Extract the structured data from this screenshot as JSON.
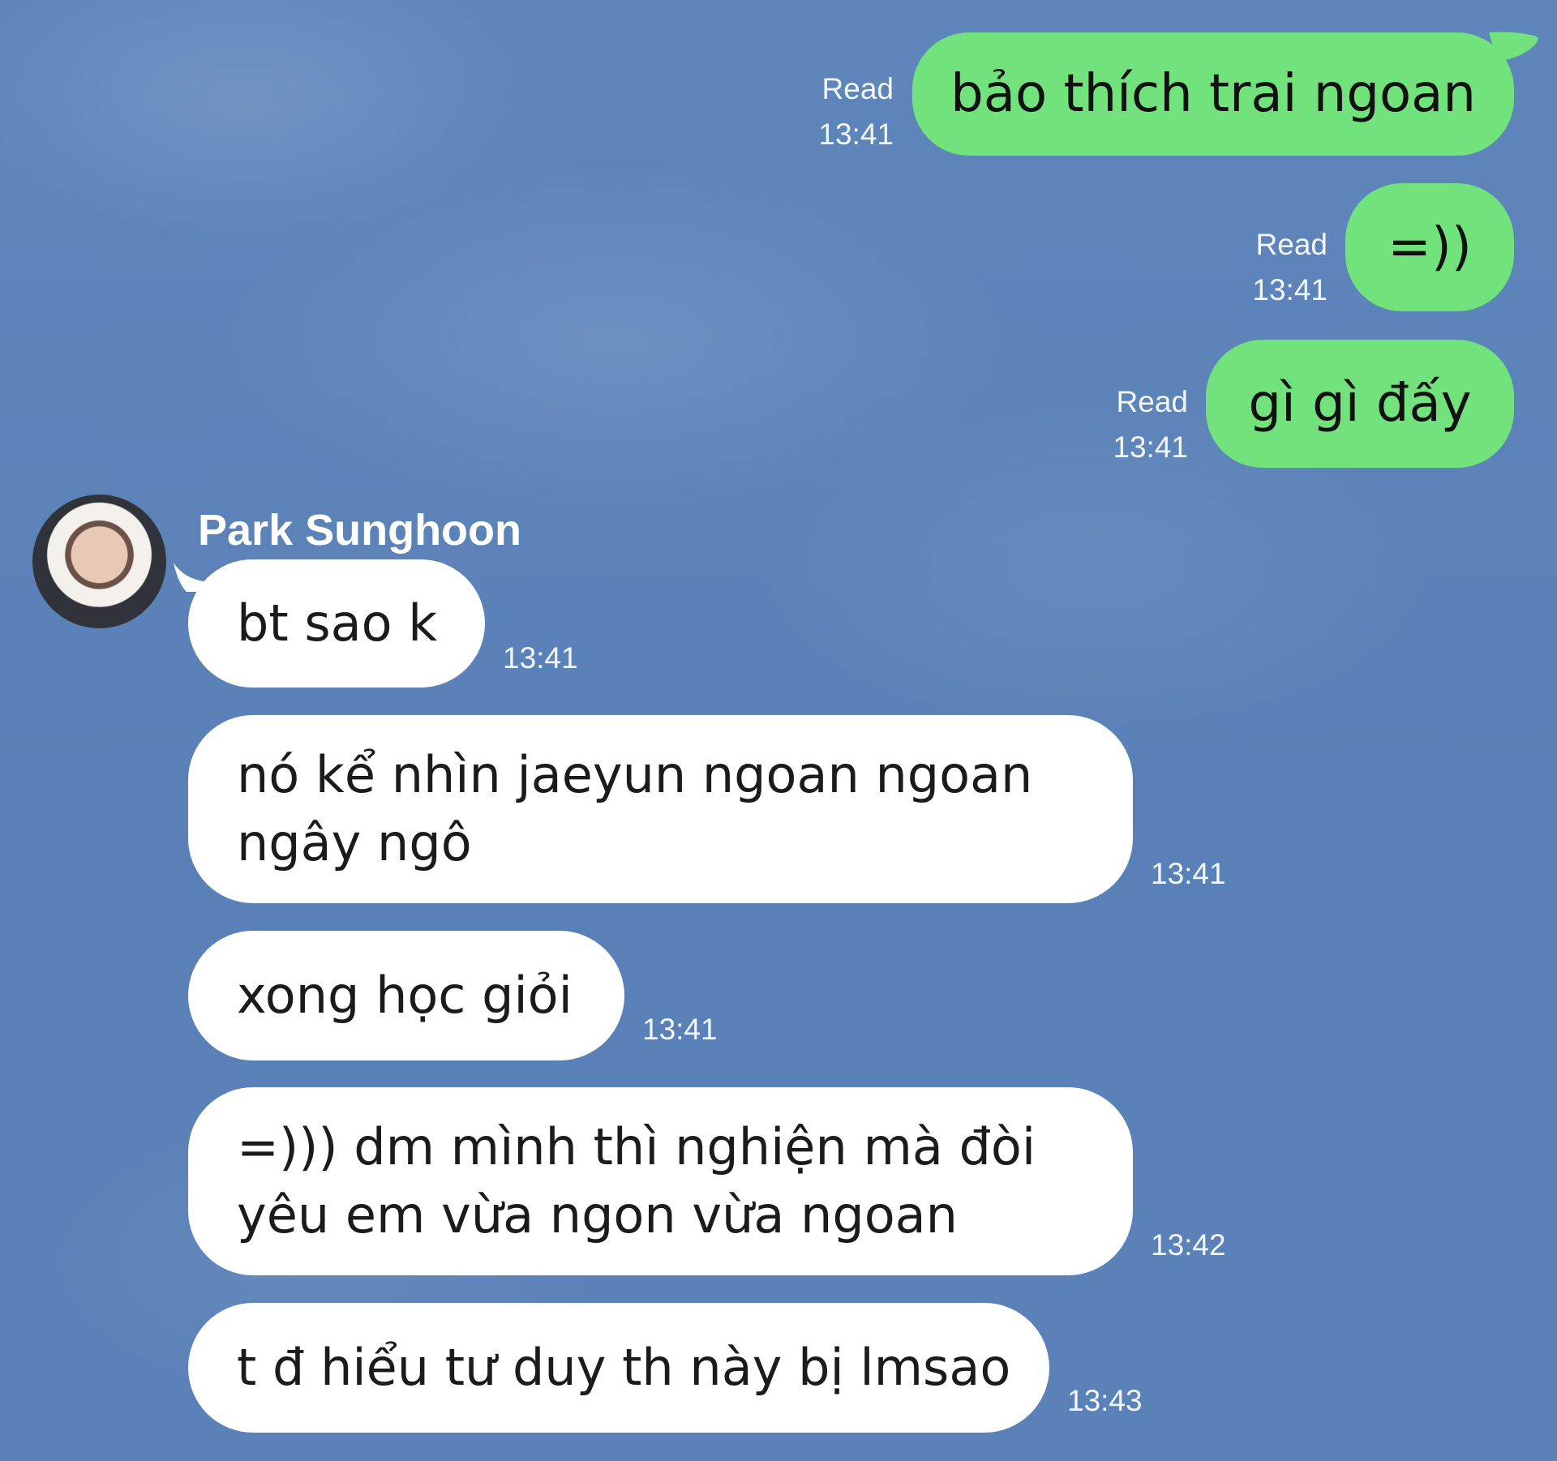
{
  "chat": {
    "outgoing": [
      {
        "text": "bảo thích trai ngoan",
        "status": "Read",
        "time": "13:41"
      },
      {
        "text": "=))",
        "status": "Read",
        "time": "13:41"
      },
      {
        "text": "gì gì đấy",
        "status": "Read",
        "time": "13:41"
      }
    ],
    "contact": {
      "name": "Park Sunghoon"
    },
    "incoming": [
      {
        "text": "bt sao k",
        "time": "13:41"
      },
      {
        "text": "nó kể nhìn jaeyun ngoan ngoan\nngây ngô",
        "time": "13:41"
      },
      {
        "text": "xong học giỏi",
        "time": "13:41"
      },
      {
        "text": "=))) dm mình thì nghiện mà đòi\nyêu em vừa ngon vừa ngoan",
        "time": "13:42"
      },
      {
        "text": "t đ hiểu tư duy th này bị lmsao",
        "time": "13:43"
      }
    ]
  },
  "colors": {
    "background": "#5b82b8",
    "outgoing_bubble": "#71e27c",
    "incoming_bubble": "#ffffff",
    "meta_text": "#f3f6fb"
  }
}
